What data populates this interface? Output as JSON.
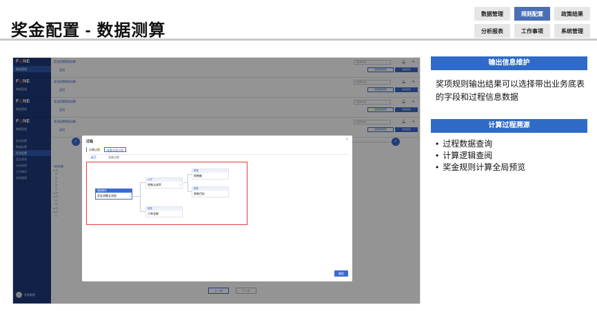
{
  "title": "奖金配置 - 数据测算",
  "nav": [
    [
      "数据管理",
      "规则配置",
      "政策结果"
    ],
    [
      "分析报表",
      "工作事项",
      "系统管理"
    ]
  ],
  "nav_active": "规则配置",
  "app": {
    "logo_prefix": "F",
    "logo_dot": "◎",
    "logo_suffix": "NE",
    "sidebar_block": [
      "数据管理"
    ],
    "sidebar_menu": [
      "奖金配置",
      "数据配置",
      "奖金配置",
      "奖金规则",
      "分析报表",
      "工作事项",
      "系统管理"
    ],
    "user": "系统管理",
    "stack_tab": "奖金配置数据测算",
    "stack_back": "返回",
    "stack_select": "请选择方案",
    "stack_btn1": "运算数据测算",
    "stack_btn2": "数据测算",
    "bottom_prev": "上一步",
    "bottom_next": "下一步",
    "tree_header": "规则配置"
  },
  "modal": {
    "title": "过程",
    "tab_active": "计算过程",
    "tab_alt": "查看全部过程",
    "back": "返回",
    "breadcrumb": "全部过程",
    "ok": "确定",
    "nodes": {
      "root": {
        "head": "规则条件",
        "body": "奖金测算全流程"
      },
      "calc": {
        "head": "公式",
        "body": "销售达成率"
      },
      "amount": {
        "head": "数据",
        "body": "订单金额"
      },
      "sales": {
        "head": "数据",
        "body": "销售额"
      },
      "target": {
        "head": "数据",
        "body": "销售目标"
      }
    }
  },
  "panel1": {
    "heading": "输出信息维护",
    "text": "奖项规则输出结果可以选择带出业务底表的字段和过程信息数据"
  },
  "panel2": {
    "heading": "计算过程溯源",
    "items": [
      "过程数据查询",
      "计算逻辑查阅",
      "奖金规则计算全局预览"
    ]
  }
}
